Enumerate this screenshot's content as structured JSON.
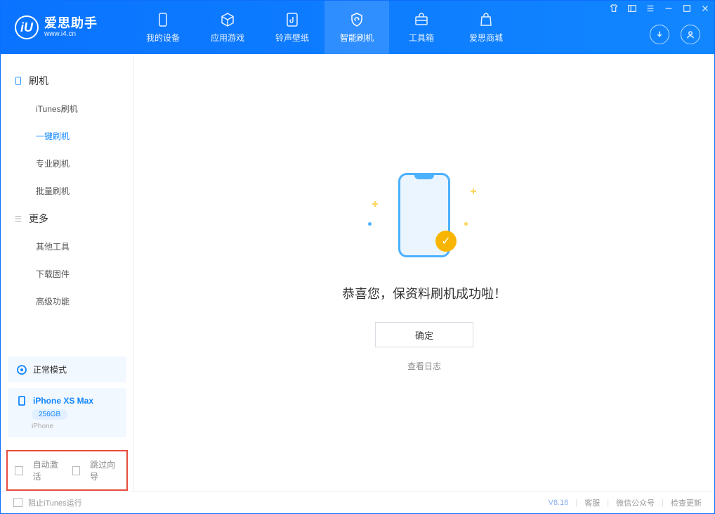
{
  "app": {
    "title": "爱思助手",
    "subtitle": "www.i4.cn",
    "logo_text": "iU"
  },
  "nav": {
    "my_device": "我的设备",
    "app_games": "应用游戏",
    "ringtone": "铃声壁纸",
    "smart_flash": "智能刷机",
    "toolbox": "工具箱",
    "store": "爱思商城"
  },
  "sidebar": {
    "group_flash": "刷机",
    "items_flash": [
      "iTunes刷机",
      "一键刷机",
      "专业刷机",
      "批量刷机"
    ],
    "active_flash_index": 1,
    "group_more": "更多",
    "items_more": [
      "其他工具",
      "下载固件",
      "高级功能"
    ]
  },
  "device": {
    "mode": "正常模式",
    "name": "iPhone XS Max",
    "storage": "256GB",
    "type": "iPhone"
  },
  "options": {
    "auto_activate": "自动激活",
    "skip_guide": "跳过向导"
  },
  "main": {
    "success_msg": "恭喜您，保资料刷机成功啦！",
    "ok_btn": "确定",
    "view_log": "查看日志"
  },
  "footer": {
    "stop_itunes": "阻止iTunes运行",
    "version": "V8.16",
    "support": "客服",
    "wechat": "微信公众号",
    "update": "检查更新"
  }
}
